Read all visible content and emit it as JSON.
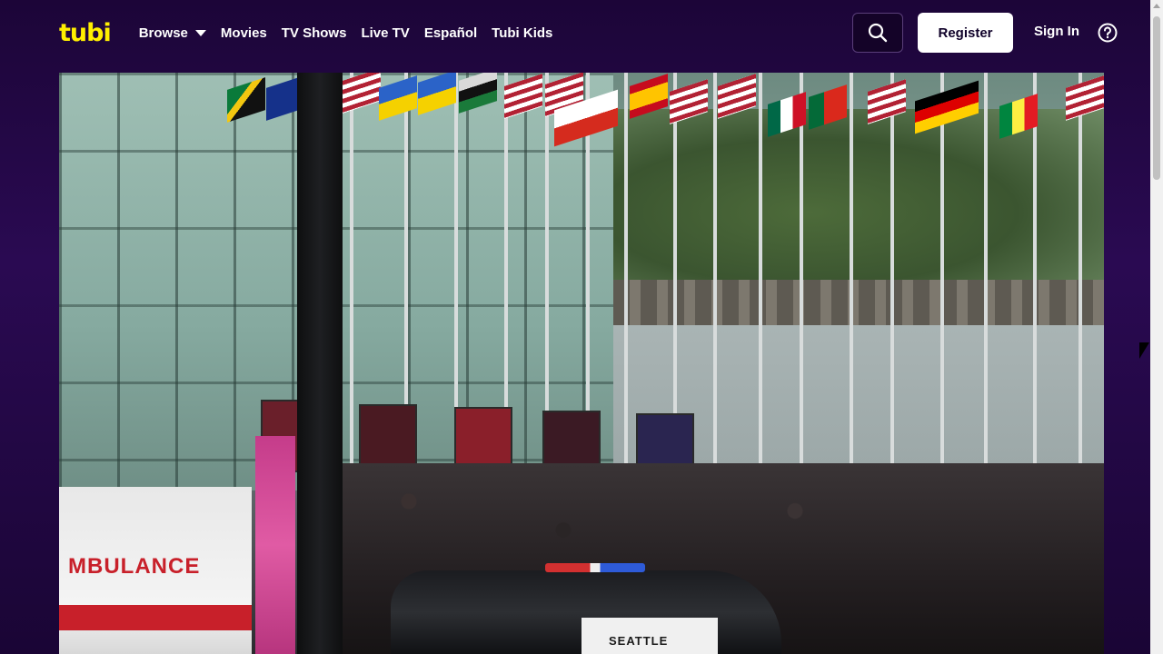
{
  "header": {
    "logo_text": "tubi",
    "nav": [
      {
        "label": "Browse",
        "has_dropdown": true
      },
      {
        "label": "Movies"
      },
      {
        "label": "TV Shows"
      },
      {
        "label": "Live TV"
      },
      {
        "label": "Español"
      },
      {
        "label": "Tubi Kids"
      }
    ],
    "search_icon": "search-icon",
    "register_label": "Register",
    "signin_label": "Sign In",
    "help_icon": "help-icon"
  },
  "video": {
    "scene_texts": {
      "ambulance": "MBULANCE",
      "police": "SEATTLE"
    }
  },
  "colors": {
    "logo": "#ffef00",
    "background": "#2a0a52",
    "register_bg": "#ffffff"
  }
}
